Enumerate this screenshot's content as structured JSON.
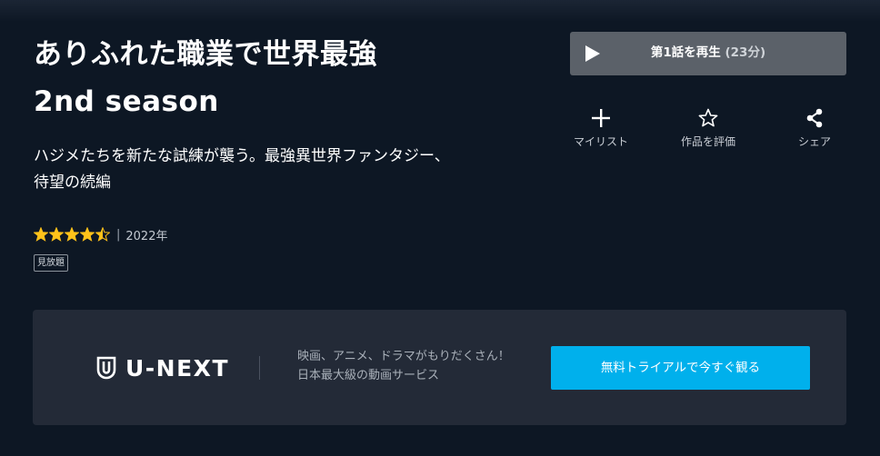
{
  "title": {
    "line1": "ありふれた職業で世界最強",
    "line2": "2nd season"
  },
  "description": "ハジメたちを新たな試練が襲う。最強異世界ファンタジー、待望の続編",
  "rating": {
    "value": 4.5,
    "max": 5,
    "separator": "|",
    "year": "2022年"
  },
  "badge": "見放題",
  "play_button": {
    "label": "第1話を再生",
    "duration": "(23分)"
  },
  "actions": {
    "mylist": "マイリスト",
    "rate": "作品を評価",
    "share": "シェア"
  },
  "promo": {
    "logo_text": "U-NEXT",
    "copy_line1": "映画、アニメ、ドラマがもりだくさん！",
    "copy_line2": "日本最大級の動画サービス",
    "trial_button": "無料トライアルで今すぐ観る"
  },
  "colors": {
    "background": "#0d1724",
    "play_button": "#5b6169",
    "promo_panel": "#232a37",
    "trial_button": "#00b0ec",
    "star": "#ffc21a"
  },
  "icons": {
    "play": "play-icon",
    "mylist": "plus-icon",
    "rate": "star-outline-icon",
    "share": "share-icon",
    "logo": "u-next-shield-icon"
  }
}
